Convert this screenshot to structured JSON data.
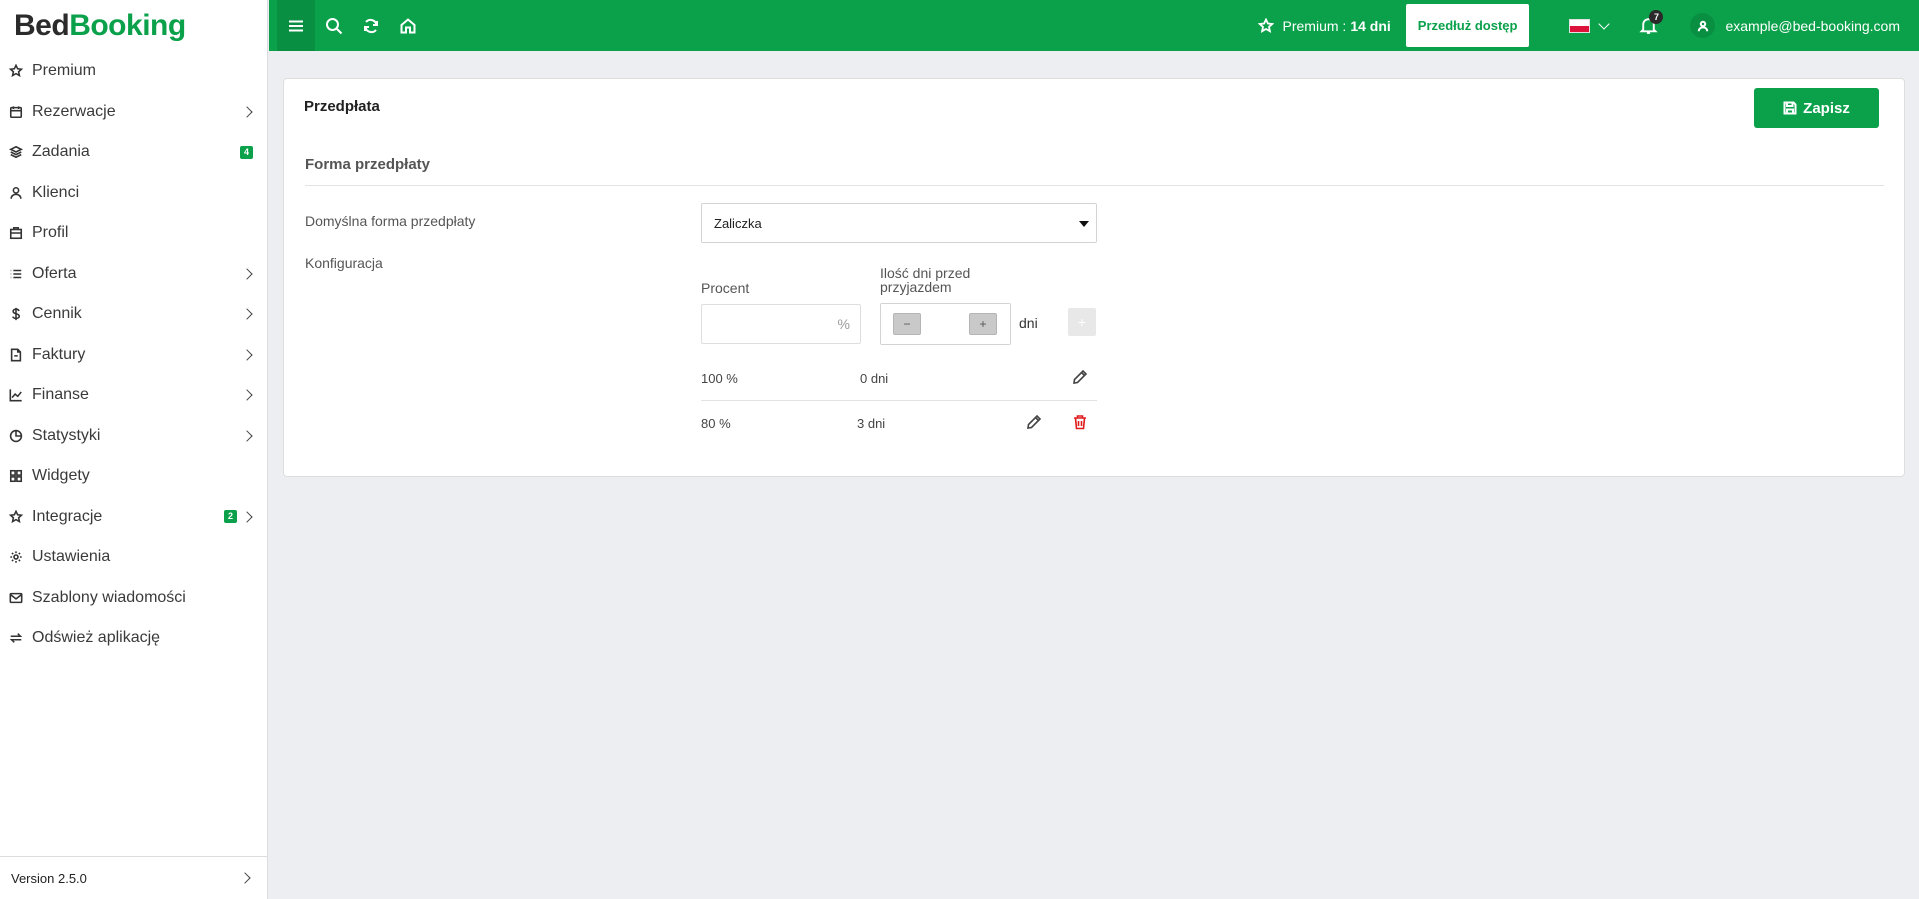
{
  "app": {
    "logo_part1": "Bed",
    "logo_part2": "Booking",
    "brand_color": "#0ba14b"
  },
  "sidebar": {
    "items": [
      {
        "label": "Premium",
        "icon": "star-icon"
      },
      {
        "label": "Rezerwacje",
        "icon": "calendar-icon"
      },
      {
        "label": "Zadania",
        "icon": "layers-icon",
        "badge": "4"
      },
      {
        "label": "Klienci",
        "icon": "user-icon"
      },
      {
        "label": "Profil",
        "icon": "building-icon"
      },
      {
        "label": "Oferta",
        "icon": "list-icon"
      },
      {
        "label": "Cennik",
        "icon": "dollar-icon"
      },
      {
        "label": "Faktury",
        "icon": "invoice-icon"
      },
      {
        "label": "Finanse",
        "icon": "chart-line-icon"
      },
      {
        "label": "Statystyki",
        "icon": "pie-chart-icon"
      },
      {
        "label": "Widgety",
        "icon": "grid-icon"
      },
      {
        "label": "Integracje",
        "icon": "star-icon",
        "badge": "2"
      },
      {
        "label": "Ustawienia",
        "icon": "gear-icon"
      },
      {
        "label": "Szablony wiadomości",
        "icon": "mail-icon"
      },
      {
        "label": "Odśwież aplikację",
        "icon": "refresh-icon"
      }
    ],
    "version": "Version 2.5.0"
  },
  "topbar": {
    "premium_label": "Premium :",
    "premium_days": "14 dni",
    "extend_label": "Przedłuż dostęp",
    "notifications_count": "7",
    "user_email": "example@bed-booking.com"
  },
  "card": {
    "title": "Przedpłata",
    "save_label": "Zapisz",
    "section_title": "Forma przedpłaty",
    "default_form_label": "Domyślna forma przedpłaty",
    "default_form_value": "Zaliczka",
    "config_label": "Konfiguracja",
    "percent_header": "Procent",
    "days_header_line1": "Ilość dni przed",
    "days_header_line2": "przyjazdem",
    "percent_unit": "%",
    "stepper_minus": "−",
    "stepper_plus": "+",
    "days_unit": "dni",
    "add_label": "+",
    "rows": [
      {
        "percent": "100 %",
        "days": "0 dni"
      },
      {
        "percent": "80 %",
        "days": "3 dni"
      }
    ]
  }
}
